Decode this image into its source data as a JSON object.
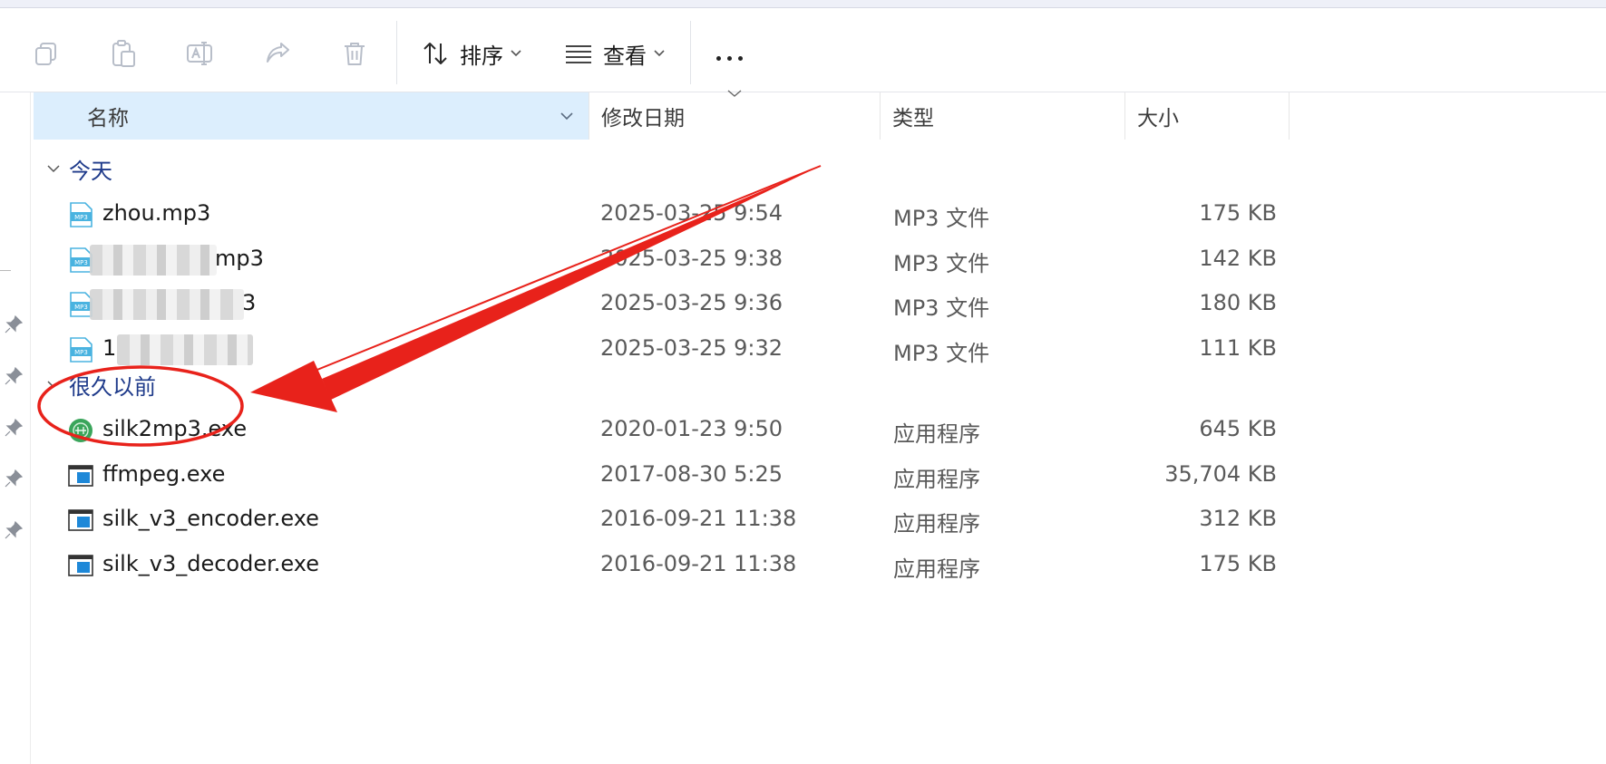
{
  "toolbar": {
    "icons": [
      "copy-icon",
      "paste-icon",
      "rename-icon",
      "share-icon",
      "delete-icon"
    ],
    "sort_label": "排序",
    "view_label": "查看",
    "more_icon": "more-icon"
  },
  "columns": {
    "name": "名称",
    "date": "修改日期",
    "type": "类型",
    "size": "大小"
  },
  "groups": {
    "today": "今天",
    "long_ago": "很久以前"
  },
  "files_today": [
    {
      "name": "zhou.mp3",
      "date": "2025-03-25 9:54",
      "type": "MP3 文件",
      "size": "175 KB",
      "icon": "mp3-file-icon"
    },
    {
      "name": "mp3",
      "date": "2025-03-25 9:38",
      "type": "MP3 文件",
      "size": "142 KB",
      "icon": "mp3-file-icon"
    },
    {
      "name": "3",
      "date": "2025-03-25 9:36",
      "type": "MP3 文件",
      "size": "180 KB",
      "icon": "mp3-file-icon"
    },
    {
      "name": "1",
      "date": "2025-03-25 9:32",
      "type": "MP3 文件",
      "size": "111 KB",
      "icon": "mp3-file-icon"
    }
  ],
  "files_old": [
    {
      "name": "silk2mp3.exe",
      "date": "2020-01-23 9:50",
      "type": "应用程序",
      "size": "645 KB",
      "icon": "silk2mp3-app-icon"
    },
    {
      "name": "ffmpeg.exe",
      "date": "2017-08-30 5:25",
      "type": "应用程序",
      "size": "35,704 KB",
      "icon": "exe-file-icon"
    },
    {
      "name": "silk_v3_encoder.exe",
      "date": "2016-09-21 11:38",
      "type": "应用程序",
      "size": "312 KB",
      "icon": "exe-file-icon"
    },
    {
      "name": "silk_v3_decoder.exe",
      "date": "2016-09-21 11:38",
      "type": "应用程序",
      "size": "175 KB",
      "icon": "exe-file-icon"
    }
  ],
  "colors": {
    "header_selected_bg": "#dceefd",
    "group_label": "#1e3a8a",
    "annotation": "#e8221b",
    "mp3_icon": "#4ab3e0",
    "app_icon": "#3aa55b"
  }
}
